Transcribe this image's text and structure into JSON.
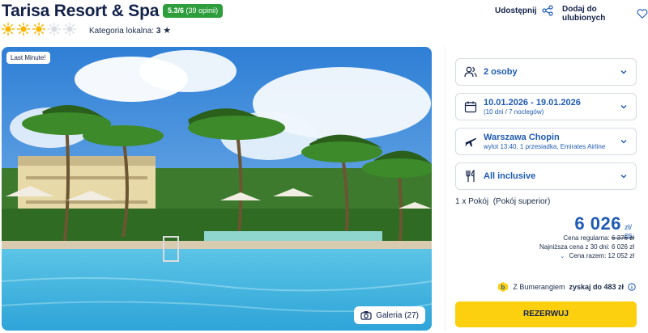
{
  "hotel": {
    "name": "Tarisa Resort & Spa",
    "rating_score": "5.3/6",
    "rating_count": "(39 opinii)",
    "suns_filled": 3,
    "suns_total": 5,
    "local_category_label": "Kategoria lokalna:",
    "local_category_value": "3"
  },
  "actions": {
    "share_label": "Udostępnij",
    "favorite_label": "Dodaj do ulubionych"
  },
  "photo": {
    "badge": "Last Minute!",
    "gallery_label": "Galeria (27)"
  },
  "booking": {
    "travelers": "2 osoby",
    "dates": "10.01.2026 - 19.01.2026",
    "dates_sub": "(10 dni / 7 noclegów)",
    "departure": "Warszawa Chopin",
    "departure_sub": "wylot 13:40, 1 przesiadka, Emirates Airline",
    "board": "All inclusive",
    "room": "1 x Pokój  (Pokój superior)",
    "price": "6 026",
    "price_unit_1": "zł/",
    "price_unit_2": "os.",
    "regular_label": "Cena regularna:",
    "regular_value": "6 376 zł",
    "lowest_label": "Najniższa cena z 30 dni:",
    "lowest_value": "6 026 zł",
    "total_label": "Cena razem:",
    "total_value": "12 052 zł",
    "bumerang_prefix": "Z Bumerangiem",
    "bumerang_bold": "zyskaj do 483 zł",
    "reserve_label": "REZERWUJ"
  },
  "colors": {
    "brand_blue": "#1e5bb4",
    "navy": "#13224a",
    "badge_green": "#2e9e3c",
    "sun_yellow": "#f7b500",
    "cta_yellow": "#fcd00f"
  }
}
